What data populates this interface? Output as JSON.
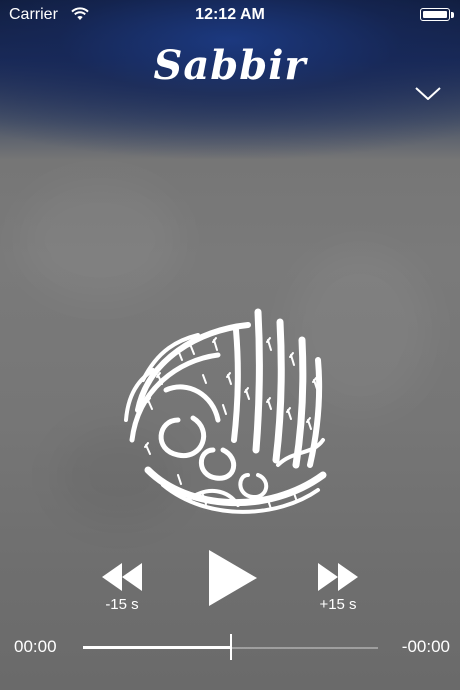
{
  "status_bar": {
    "carrier": "Carrier",
    "time": "12:12 AM",
    "wifi_icon": "wifi-icon",
    "battery_icon": "battery-full-icon"
  },
  "header": {
    "title": "Sabbir",
    "collapse_icon": "chevron-down-icon"
  },
  "artwork": {
    "icon": "quran-calligraphy-logo"
  },
  "controls": {
    "rewind_icon": "rewind-icon",
    "rewind_label": "-15 s",
    "play_icon": "play-icon",
    "forward_icon": "fast-forward-icon",
    "forward_label": "+15 s"
  },
  "progress": {
    "elapsed": "00:00",
    "remaining": "-00:00",
    "position_fraction": 0.5
  },
  "colors": {
    "background": "#707070",
    "header_glow": "#1c3a82",
    "foreground": "#ffffff"
  }
}
